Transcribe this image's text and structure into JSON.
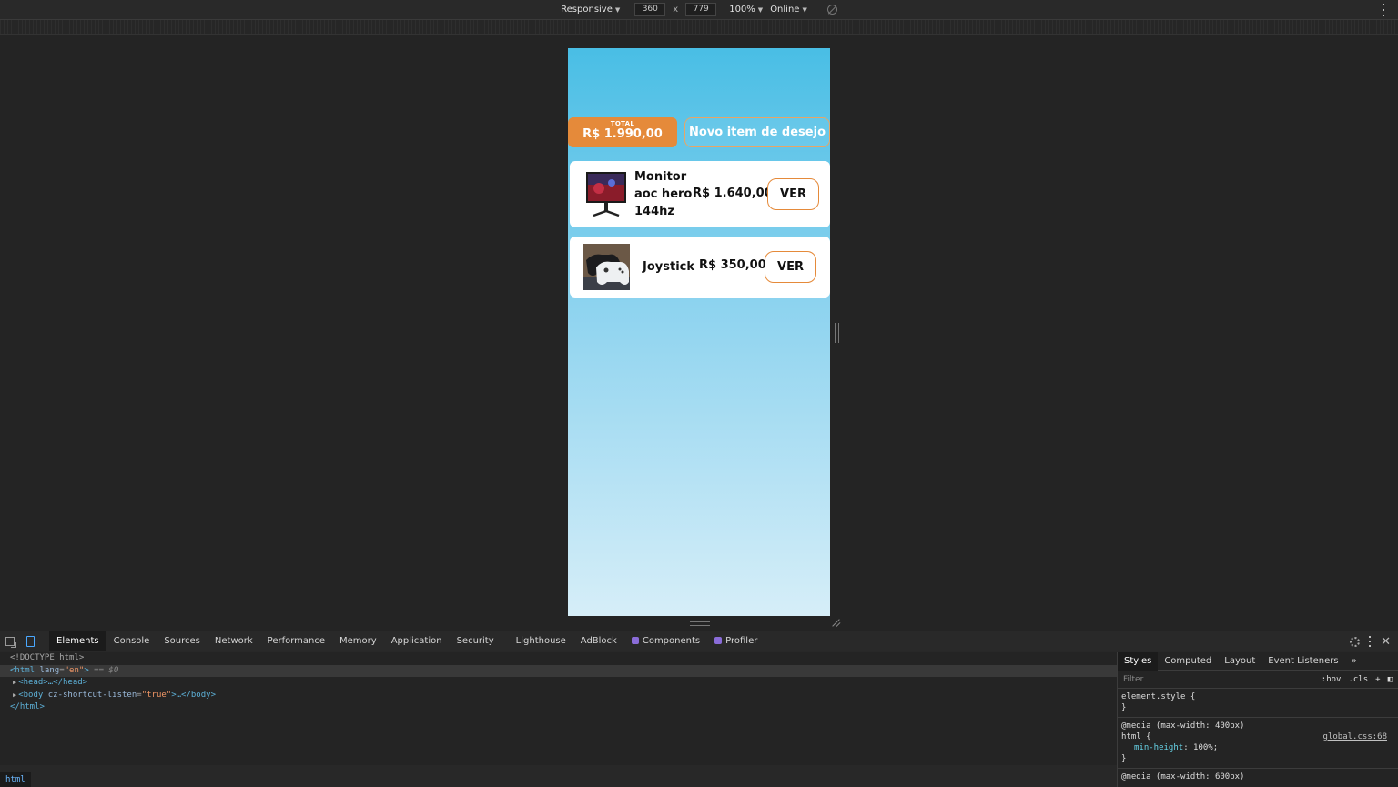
{
  "toolbar": {
    "device_mode": "Responsive",
    "width": "360",
    "height": "779",
    "times": "x",
    "zoom": "100%",
    "network": "Online"
  },
  "app": {
    "total_label": "TOTAL",
    "total_value": "R$ 1.990,00",
    "new_item_button": "Novo item de desejo",
    "items": [
      {
        "name": "Monitor aoc hero 144hz",
        "price": "R$ 1.640,00",
        "button": "VER"
      },
      {
        "name": "Joystick",
        "price": "R$ 350,00",
        "button": "VER"
      }
    ]
  },
  "devtools": {
    "tabs": [
      "Elements",
      "Console",
      "Sources",
      "Network",
      "Performance",
      "Memory",
      "Application",
      "Security",
      "Lighthouse",
      "AdBlock",
      "Components",
      "Profiler"
    ],
    "active_tab": "Elements",
    "dom": {
      "doctype": "<!DOCTYPE html>",
      "html_open": "<html",
      "lang_attr": "lang",
      "lang_val": "\"en\"",
      "html_close_bracket": ">",
      "selected_marker": "== $0",
      "head": "<head>…</head>",
      "body_open": "<body",
      "body_attr": "cz-shortcut-listen",
      "body_val": "\"true\"",
      "body_rest": ">…</body>",
      "html_end": "</html>"
    },
    "breadcrumb": "html",
    "styles_tabs": [
      "Styles",
      "Computed",
      "Layout",
      "Event Listeners"
    ],
    "filter_placeholder": "Filter",
    "filter_hov": ":hov",
    "filter_cls": ".cls",
    "rules": {
      "element_style": "element.style {",
      "close_brace": "}",
      "media1": "@media (max-width: 400px)",
      "selector": "html {",
      "source": "global.css:68",
      "prop_name": "min-height",
      "prop_value": "100%;",
      "media2": "@media (max-width: 600px)"
    }
  }
}
